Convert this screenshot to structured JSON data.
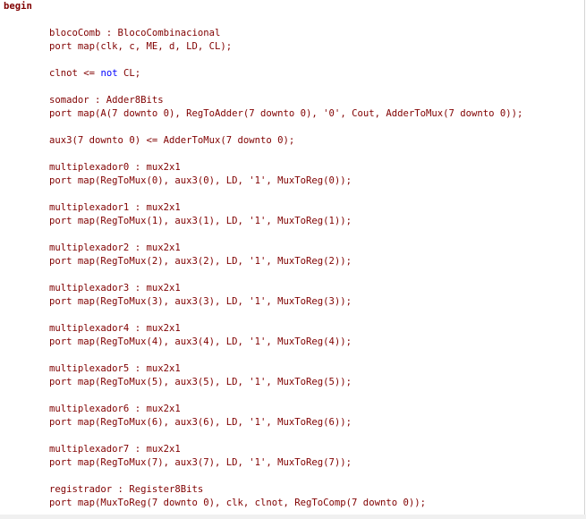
{
  "editor": {
    "lines": [
      [
        {
          "t": "begin",
          "c": "kw"
        }
      ],
      [],
      [
        {
          "t": "        blocoComb : BlocoCombinacional",
          "c": "id"
        }
      ],
      [
        {
          "t": "        port map(clk, c, ME, d, LD, CL);",
          "c": "id"
        }
      ],
      [],
      [
        {
          "t": "        clnot <= ",
          "c": "id"
        },
        {
          "t": "not",
          "c": "blue"
        },
        {
          "t": " CL;",
          "c": "id"
        }
      ],
      [],
      [
        {
          "t": "        somador : Adder8Bits",
          "c": "id"
        }
      ],
      [
        {
          "t": "        port map(A(7 ",
          "c": "id"
        },
        {
          "t": "downto",
          "c": "id"
        },
        {
          "t": " 0), RegToAdder(7 downto 0), '0', Cout, AdderToMux(7 downto 0));",
          "c": "id"
        }
      ],
      [],
      [
        {
          "t": "        aux3(7 downto 0) <= AdderToMux(7 downto 0);",
          "c": "id"
        }
      ],
      [],
      [
        {
          "t": "        multiplexador0 : mux2x1",
          "c": "id"
        }
      ],
      [
        {
          "t": "        port map(RegToMux(0), aux3(0), LD, '1', MuxToReg(0));",
          "c": "id"
        }
      ],
      [],
      [
        {
          "t": "        multiplexador1 : mux2x1",
          "c": "id"
        }
      ],
      [
        {
          "t": "        port map(RegToMux(1), aux3(1), LD, '1', MuxToReg(1));",
          "c": "id"
        }
      ],
      [],
      [
        {
          "t": "        multiplexador2 : mux2x1",
          "c": "id"
        }
      ],
      [
        {
          "t": "        port map(RegToMux(2), aux3(2), LD, '1', MuxToReg(2));",
          "c": "id"
        }
      ],
      [],
      [
        {
          "t": "        multiplexador3 : mux2x1",
          "c": "id"
        }
      ],
      [
        {
          "t": "        port map(RegToMux(3), aux3(3), LD, '1', MuxToReg(3));",
          "c": "id"
        }
      ],
      [],
      [
        {
          "t": "        multiplexador4 : mux2x1",
          "c": "id"
        }
      ],
      [
        {
          "t": "        port map(RegToMux(4), aux3(4), LD, '1', MuxToReg(4));",
          "c": "id"
        }
      ],
      [],
      [
        {
          "t": "        multiplexador5 : mux2x1",
          "c": "id"
        }
      ],
      [
        {
          "t": "        port map(RegToMux(5), aux3(5), LD, '1', MuxToReg(5));",
          "c": "id"
        }
      ],
      [],
      [
        {
          "t": "        multiplexador6 : mux2x1",
          "c": "id"
        }
      ],
      [
        {
          "t": "        port map(RegToMux(6), aux3(6), LD, '1', MuxToReg(6));",
          "c": "id"
        }
      ],
      [],
      [
        {
          "t": "        multiplexador7 : mux2x1",
          "c": "id"
        }
      ],
      [
        {
          "t": "        port map(RegToMux(7), aux3(7), LD, '1', MuxToReg(7));",
          "c": "id"
        }
      ],
      [],
      [
        {
          "t": "        registrador : Register8Bits",
          "c": "id"
        }
      ],
      [
        {
          "t": "        port map(MuxToReg(7 downto 0), clk, clnot, RegToComp(7 downto 0));",
          "c": "id"
        }
      ]
    ]
  },
  "colors": {
    "keyword": "#800000",
    "identifier": "#800000",
    "blue_keyword": "#0000ff",
    "background": "#ffffff"
  }
}
